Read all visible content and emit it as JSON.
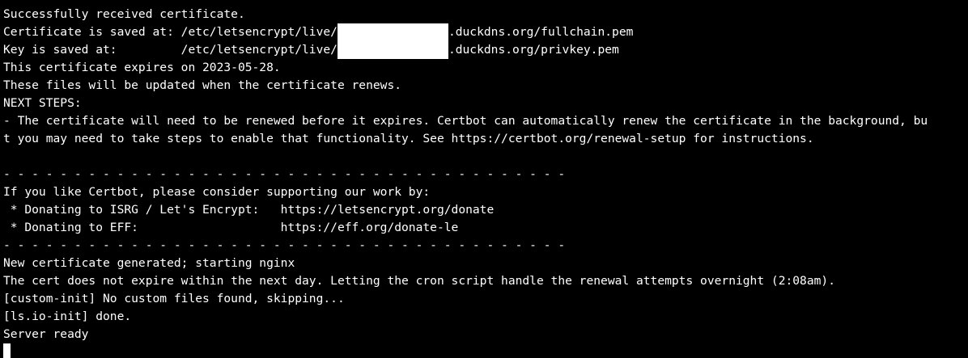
{
  "colors": {
    "background": "#000000",
    "foreground": "#ffffff"
  },
  "terminal": {
    "lines": {
      "l1": "Successfully received certificate.",
      "l2_pre": "Certificate is saved at: /etc/letsencrypt/live/",
      "l2_post": ".duckdns.org/fullchain.pem",
      "l3_pre": "Key is saved at:         /etc/letsencrypt/live/",
      "l3_post": ".duckdns.org/privkey.pem",
      "l4": "This certificate expires on 2023-05-28.",
      "l5": "These files will be updated when the certificate renews.",
      "l6": "NEXT STEPS:",
      "l7": "- The certificate will need to be renewed before it expires. Certbot can automatically renew the certificate in the background, bu",
      "l8": "t you may need to take steps to enable that functionality. See https://certbot.org/renewal-setup for instructions.",
      "l9": "",
      "l10": "- - - - - - - - - - - - - - - - - - - - - - - - - - - - - - - - - - - - - - - -",
      "l11": "If you like Certbot, please consider supporting our work by:",
      "l12": " * Donating to ISRG / Let's Encrypt:   https://letsencrypt.org/donate",
      "l13": " * Donating to EFF:                    https://eff.org/donate-le",
      "l14": "- - - - - - - - - - - - - - - - - - - - - - - - - - - - - - - - - - - - - - - -",
      "l15": "New certificate generated; starting nginx",
      "l16": "The cert does not expire within the next day. Letting the cron script handle the renewal attempts overnight (2:08am).",
      "l17": "[custom-init] No custom files found, skipping...",
      "l18": "[ls.io-init] done.",
      "l19": "Server ready"
    }
  }
}
